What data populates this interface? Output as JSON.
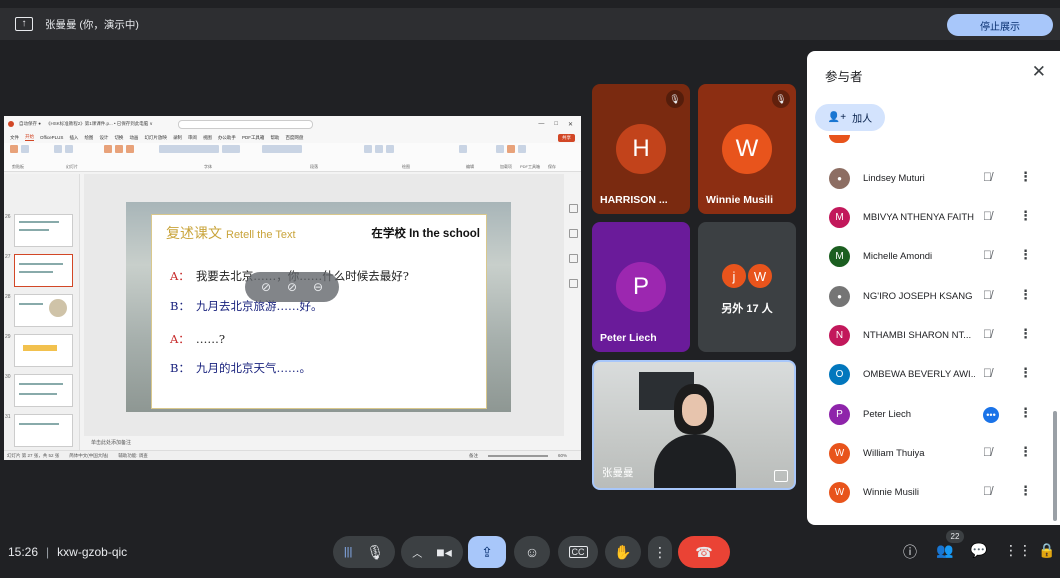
{
  "topbar": {
    "status": "张曼曼 (你，演示中)",
    "stop_label": "停止展示"
  },
  "presentation": {
    "title": "《HSK标准教程2》第1课课件.p... • 已保存到此电脑 ∨",
    "tabs": [
      "文件",
      "开始",
      "OfficePLUS",
      "插入",
      "绘图",
      "设计",
      "切换",
      "动画",
      "幻灯片放映",
      "录制",
      "审阅",
      "视图",
      "办公助手",
      "PDF工具箱",
      "帮助",
      "百度网盘"
    ],
    "active_tab": "开始",
    "share": "共享",
    "ribbon_groups": [
      "剪贴板",
      "幻灯片",
      "字体",
      "段落",
      "绘图",
      "编辑",
      "加载项",
      "PDF工具箱",
      "保存"
    ],
    "thumb_numbers": [
      "26",
      "27",
      "28",
      "29",
      "30",
      "31"
    ],
    "notes": "单击此处添加备注",
    "status_left": "幻灯片 第 27 张，共 52 张",
    "status_lang": "简体中文(中国大陆)",
    "status_access": "辅助功能: 调查",
    "status_notes": "备注",
    "zoom": "60%"
  },
  "slide": {
    "heading_cn": "复述课文",
    "heading_en": "Retell the Text",
    "school": "在学校 In the school",
    "lines": [
      {
        "speaker": "A：",
        "text": "我要去北京……，你……什么时候去最好?"
      },
      {
        "speaker": "B：",
        "text": "九月去北京旅游……好。"
      },
      {
        "speaker": "A：",
        "text": "……?"
      },
      {
        "speaker": "B：",
        "text": "九月的北京天气……。"
      }
    ]
  },
  "tiles": [
    {
      "initial": "H",
      "name": "HARRISON ...",
      "bg": "#7a2a10",
      "avatar": "#c2431b"
    },
    {
      "initial": "W",
      "name": "Winnie Musili",
      "bg": "#8c2e12",
      "avatar": "#e8541c"
    },
    {
      "initial": "P",
      "name": "Peter Liech",
      "bg": "#6a1b9a",
      "avatar": "#9c27b0"
    },
    {
      "others_label": "另外 17 人",
      "mini": [
        "j",
        "W"
      ]
    },
    {
      "name": "张曼曼"
    }
  ],
  "panel": {
    "title": "参与者",
    "add_label": "加人",
    "participants": [
      {
        "name": "Lindsey Muturi",
        "initial": "",
        "color": "#6b4f3a",
        "status": "muted"
      },
      {
        "name": "MBIVYA NTHENYA FAITH",
        "initial": "M",
        "color": "#c2185b",
        "status": "muted"
      },
      {
        "name": "Michelle Amondi",
        "initial": "M",
        "color": "#1b5e20",
        "status": "muted"
      },
      {
        "name": "NG'IRO JOSEPH KSANG",
        "initial": "",
        "color": "#5f6368",
        "status": "muted"
      },
      {
        "name": "NTHAMBI SHARON NT...",
        "initial": "N",
        "color": "#c2185b",
        "status": "muted"
      },
      {
        "name": "OMBEWA BEVERLY AWI...",
        "initial": "O",
        "color": "#0277bd",
        "status": "muted"
      },
      {
        "name": "Peter Liech",
        "initial": "P",
        "color": "#8e24aa",
        "status": "speaking"
      },
      {
        "name": "William Thuiya",
        "initial": "W",
        "color": "#e8541c",
        "status": "muted"
      },
      {
        "name": "Winnie Musili",
        "initial": "W",
        "color": "#e8541c",
        "status": "muted"
      }
    ]
  },
  "bottombar": {
    "time": "15:26",
    "separator": "|",
    "meeting_code": "kxw-gzob-qic",
    "participant_count": "22"
  }
}
